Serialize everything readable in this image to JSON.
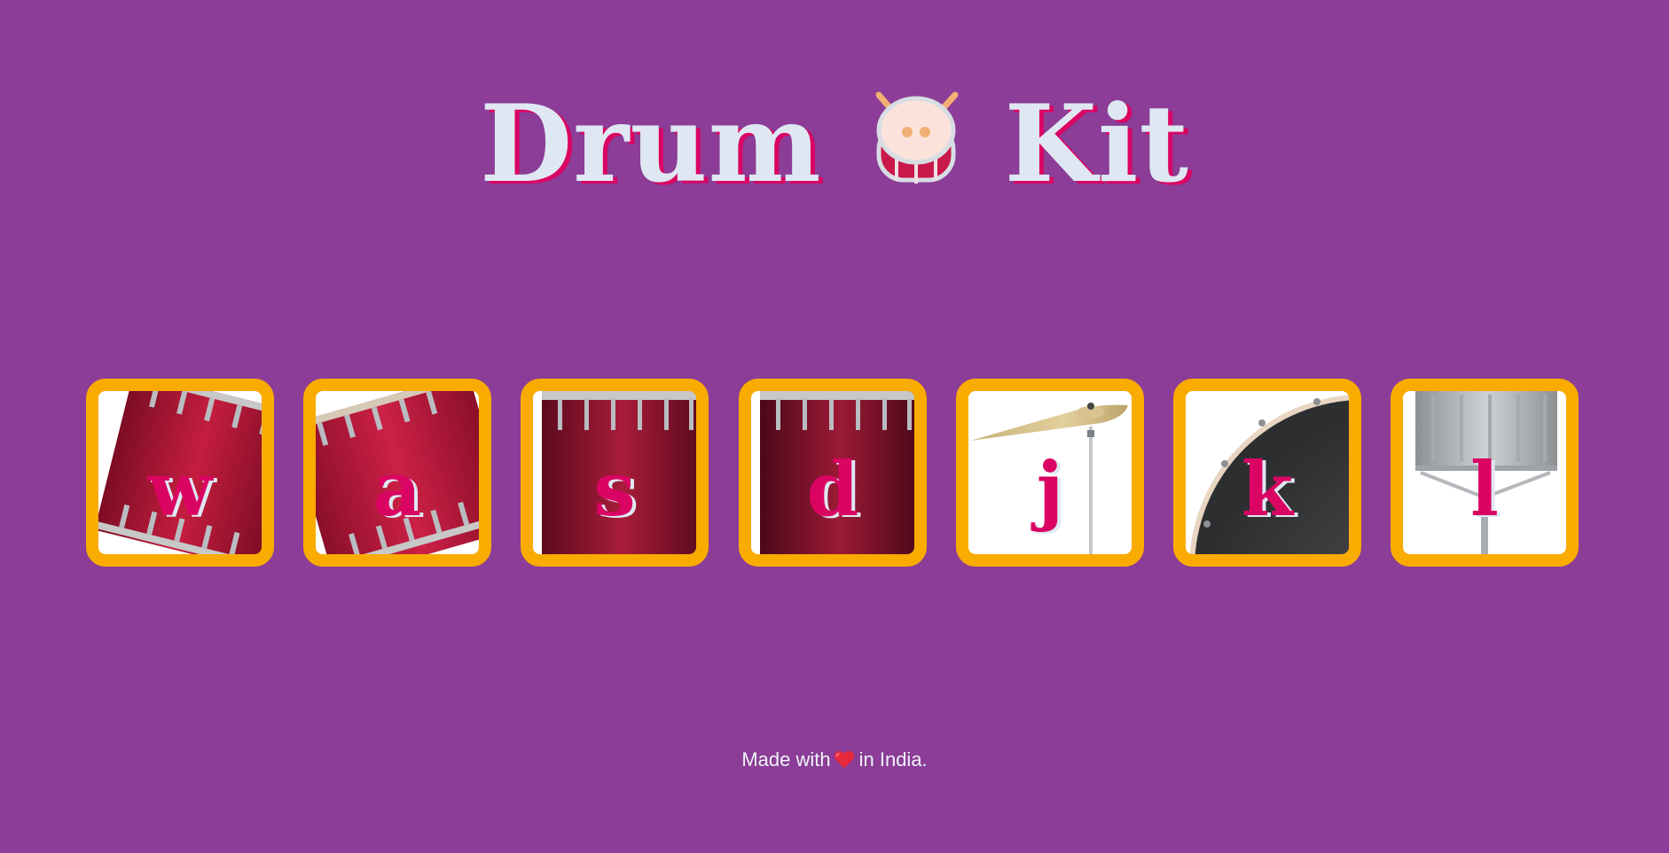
{
  "header": {
    "title_left": "Drum",
    "title_right": "Kit",
    "title_icon": "drum-icon"
  },
  "drums": [
    {
      "key": "w",
      "image": "tom-1-icon"
    },
    {
      "key": "a",
      "image": "tom-2-icon"
    },
    {
      "key": "s",
      "image": "tom-3-icon"
    },
    {
      "key": "d",
      "image": "tom-4-icon"
    },
    {
      "key": "j",
      "image": "crash-cymbal-icon"
    },
    {
      "key": "k",
      "image": "kick-drum-icon"
    },
    {
      "key": "l",
      "image": "snare-drum-icon"
    }
  ],
  "footer": {
    "text_before": "Made with",
    "text_after": "in India.",
    "icon": "heart-icon"
  },
  "colors": {
    "background": "#8b3d97",
    "title_text": "#dfe8f2",
    "accent_pink": "#da0463",
    "button_border": "#f9ab00"
  }
}
